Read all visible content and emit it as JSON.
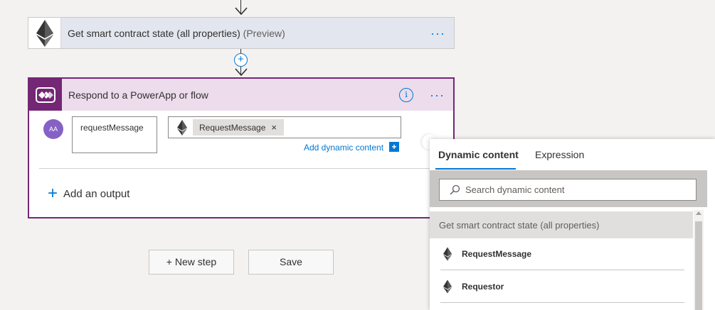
{
  "card1": {
    "title": "Get smart contract state (all properties)",
    "tag": "(Preview)",
    "icon": "ethereum-icon",
    "more": "···"
  },
  "insert_step": {
    "label": "+"
  },
  "card2": {
    "title": "Respond to a PowerApp or flow",
    "icon": "powerapps-icon",
    "info": "i",
    "more": "···",
    "avatar_text": "AA",
    "output_name": "requestMessage",
    "token_label": "RequestMessage",
    "token_remove": "×",
    "add_dynamic_label": "Add dynamic content",
    "add_dynamic_icon": "+",
    "add_output_plus": "+",
    "add_output_label": "Add an output"
  },
  "buttons": {
    "new_step": "+ New step",
    "save": "Save"
  },
  "panel": {
    "tabs": [
      "Dynamic content",
      "Expression"
    ],
    "active_tab": "Dynamic content",
    "search_placeholder": "Search dynamic content",
    "group_header": "Get smart contract state (all properties)",
    "items": [
      {
        "label": "RequestMessage",
        "icon": "ethereum-icon"
      },
      {
        "label": "Requestor",
        "icon": "ethereum-icon"
      }
    ]
  },
  "colors": {
    "accent": "#0078d4",
    "powerapps_purple": "#742774",
    "header_lilac": "#ecdcec",
    "card1_header": "#e3e6ee"
  }
}
